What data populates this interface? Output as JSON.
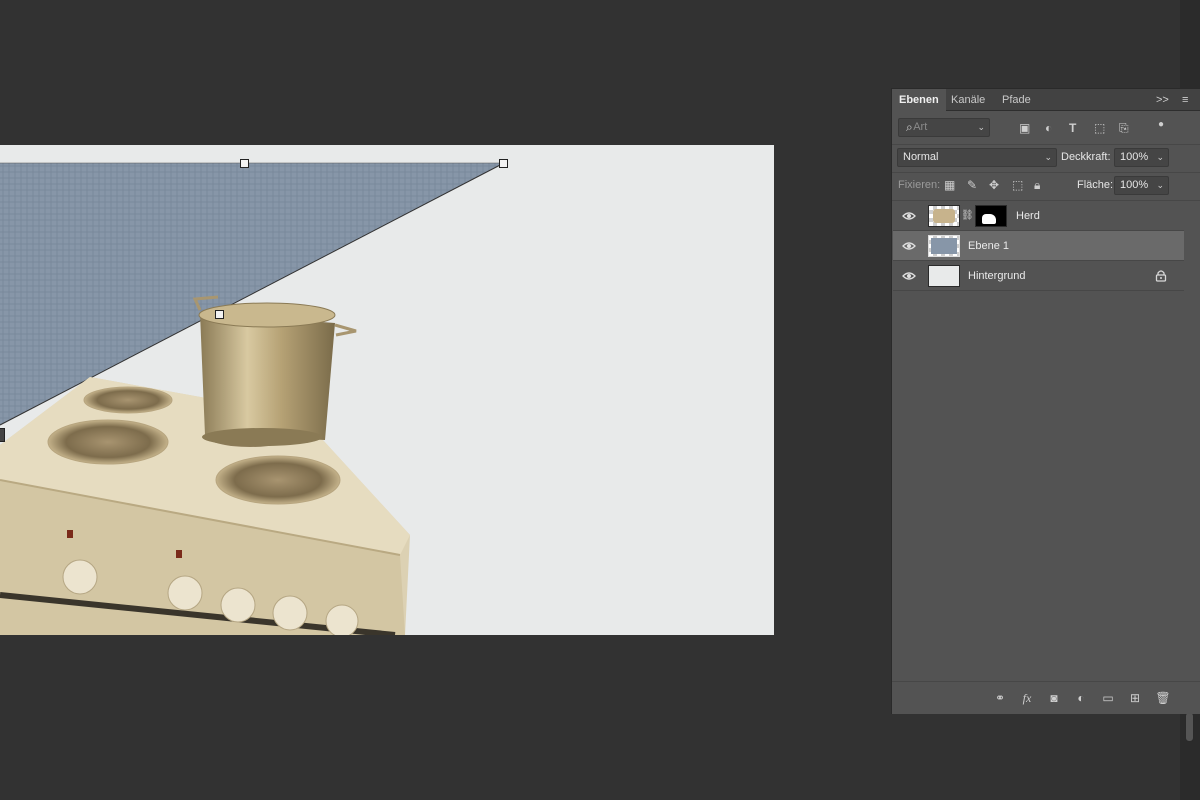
{
  "panel": {
    "tabs": [
      {
        "label": "Ebenen",
        "active": true
      },
      {
        "label": "Kanäle",
        "active": false
      },
      {
        "label": "Pfade",
        "active": false
      }
    ],
    "tab_controls": {
      "collapse": ">>",
      "menu": "≡"
    },
    "filter": {
      "placeholder": "Art"
    },
    "blend_mode": "Normal",
    "opacity_label": "Deckkraft:",
    "opacity_value": "100%",
    "lock_label": "Fixieren:",
    "fill_label": "Fläche:",
    "fill_value": "100%",
    "layers": [
      {
        "name": "Herd",
        "visible": true,
        "selected": false,
        "has_mask": true,
        "locked": false
      },
      {
        "name": "Ebene 1",
        "visible": true,
        "selected": true,
        "has_mask": false,
        "locked": false
      },
      {
        "name": "Hintergrund",
        "visible": true,
        "selected": false,
        "has_mask": false,
        "locked": true
      }
    ]
  },
  "icons": {
    "search": "search-icon",
    "eye": "eye-icon",
    "lock": "lock-icon",
    "link": "link-icon",
    "fx": "fx-icon",
    "mask": "mask-icon",
    "adjustment": "adjustment-icon",
    "folder": "folder-icon",
    "new_layer": "new-layer-icon",
    "trash": "trash-icon"
  },
  "colors": {
    "workspace": "#323232",
    "panel": "#535353",
    "selected_layer": "#6a6a6a",
    "canvas_bg": "#e8eaea"
  }
}
